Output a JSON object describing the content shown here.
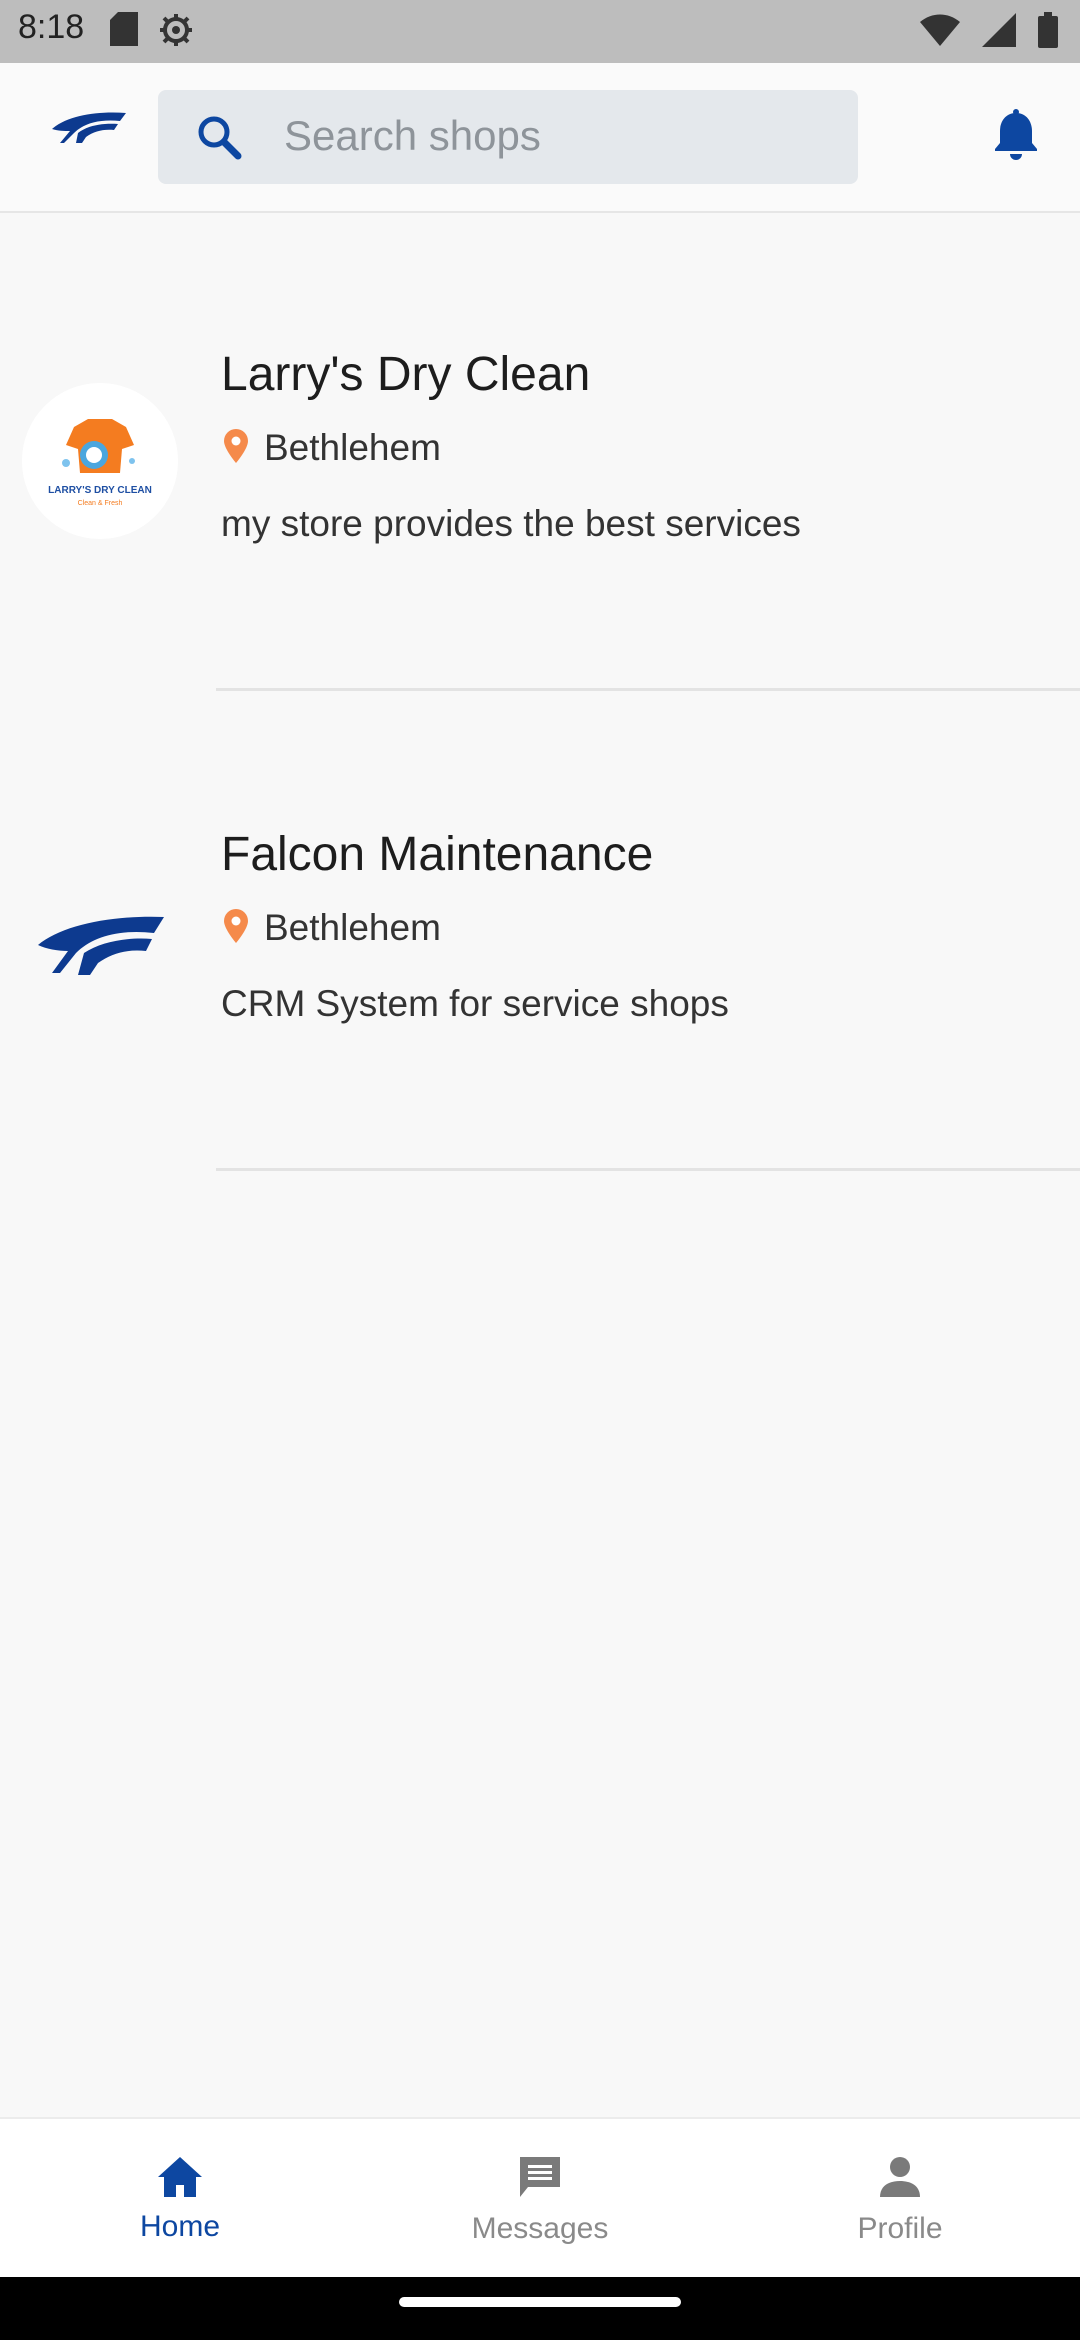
{
  "status_bar": {
    "time": "8:18",
    "icons": [
      "sd-card-icon",
      "settings-icon",
      "wifi-icon",
      "signal-icon",
      "battery-icon"
    ]
  },
  "header": {
    "search": {
      "placeholder": "Search shops",
      "value": ""
    },
    "icons": [
      "app-logo-icon",
      "search-icon",
      "notification-bell-icon"
    ],
    "accent_color": "#0d47a1"
  },
  "shops": [
    {
      "name": "Larry's Dry Clean",
      "location": "Bethlehem",
      "description": "my store provides the best services",
      "logo_text": "LARRY'S DRY CLEAN",
      "logo_tagline": "Clean & Fresh"
    },
    {
      "name": "Falcon Maintenance",
      "location": "Bethlehem",
      "description": "CRM System for service shops"
    }
  ],
  "location_pin_color": "#f58a4b",
  "bottom_nav": {
    "items": [
      {
        "label": "Home",
        "icon": "home-icon",
        "active": true
      },
      {
        "label": "Messages",
        "icon": "message-icon",
        "active": false
      },
      {
        "label": "Profile",
        "icon": "person-icon",
        "active": false
      }
    ]
  }
}
